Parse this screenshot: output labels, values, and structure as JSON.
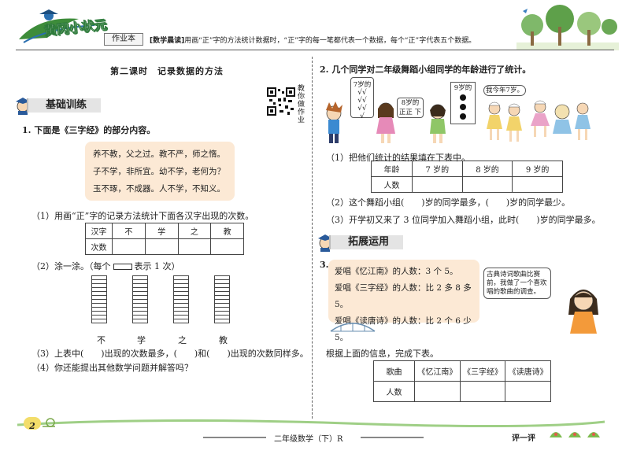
{
  "header": {
    "logo": "黄冈小状元",
    "notebook": "作业本",
    "reading_tag": "[数学晨读]",
    "reading_text": "用画“正”字的方法统计数据时，“正”字的每一笔都代表一个数据，每个“正”字代表五个数据。"
  },
  "lesson": {
    "title": "第二课时　记录数据的方法",
    "qr_caption": "教你做作业"
  },
  "sections": {
    "basic": "基础训练",
    "extend": "拓展运用"
  },
  "q1": {
    "prompt": "1. 下面是《三字经》的部分内容。",
    "poem": [
      "养不教，父之过。教不严，师之惰。",
      "子不学，非所宜。幼不学，老何为？",
      "玉不琢，不成器。人不学，不知义。"
    ],
    "sub1": "（1）用画“正”字的记录方法统计下面各汉字出现的次数。",
    "table_headers": [
      "汉字",
      "不",
      "学",
      "之",
      "教"
    ],
    "table_row_label": "次数",
    "sub2_a": "（2）涂一涂。（每个",
    "sub2_b": "表示 1 次）",
    "bar_labels": [
      "不",
      "学",
      "之",
      "教"
    ],
    "sub3": "（3）上表中(　　)出现的次数最多，(　　)和(　　)出现的次数同样多。",
    "sub4": "（4）你还能提出其他数学问题并解答吗？"
  },
  "q2": {
    "prompt": "2. 几个同学对二年级舞蹈小组同学的年龄进行了统计。",
    "bubble_7": "7岁的",
    "ticks": "√√\n√√\n√√\n√",
    "bubble_8": "8岁的",
    "bubble_8_tally": "正正 下",
    "bubble_9": "9岁的",
    "bubble_me": "我今年7岁。",
    "sub1": "（1）把他们统计的结果填在下表中。",
    "table_headers": [
      "年龄",
      "7 岁的",
      "8 岁的",
      "9 岁的"
    ],
    "table_row_label": "人数",
    "sub2": "（2）这个舞蹈小组(　　)岁的同学最多，(　　)岁的同学最少。",
    "sub3": "（3）开学初又来了 3 位同学加入舞蹈小组，此时(　　)岁的同学最多。"
  },
  "q3": {
    "number": "3.",
    "lines": [
      "爱唱《忆江南》的人数：3 个 5。",
      "爱唱《三字经》的人数：比 2 多 8 多 5。",
      "爱唱《读唐诗》的人数：比 2 个 6 少 5。"
    ],
    "speech": "古典诗词歌曲比赛前，我做了一个喜欢唱的歌曲的调查。",
    "instruction": "根据上面的信息，完成下表。",
    "table_headers": [
      "歌曲",
      "《忆江南》",
      "《三字经》",
      "《读唐诗》"
    ],
    "table_row_label": "人数"
  },
  "footer": {
    "page_no": "2",
    "book": "二年级数学（下）R",
    "review": "评一评"
  },
  "colors": {
    "accent_green": "#4a9a3e",
    "box_fill": "#fce9d5",
    "banner_fill": "#e4e4e4"
  }
}
